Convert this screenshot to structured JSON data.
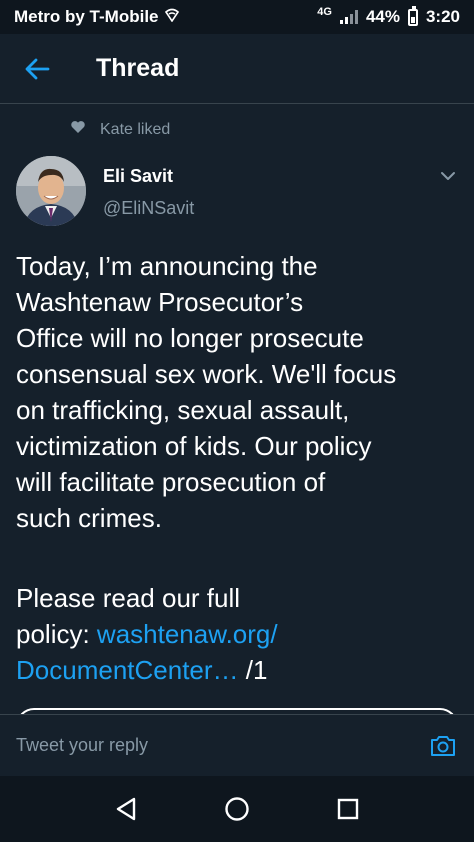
{
  "status_bar": {
    "carrier": "Metro by T-Mobile",
    "network": "4G",
    "battery": "44%",
    "time": "3:20"
  },
  "header": {
    "title": "Thread"
  },
  "liked": {
    "text": "Kate liked"
  },
  "tweet": {
    "author_name": "Eli Savit",
    "author_handle": "@EliNSavit",
    "text": "Today, I’m announcing the\nWashtenaw Prosecutor’s\nOffice will no longer prosecute\nconsensual sex work. We'll focus\non trafficking, sexual assault,\nvictimization of kids. Our policy\nwill facilitate prosecution of\nsuch crimes.",
    "text2_prefix": "Please read our full\npolicy: ",
    "link_line1": "washtenaw.org/",
    "link_line2": "DocumentCenter…",
    "suffix": " /1"
  },
  "reply": {
    "placeholder": "Tweet your reply"
  },
  "colors": {
    "background": "#15202b",
    "accent": "#1da1f2",
    "muted": "#8899a6"
  }
}
